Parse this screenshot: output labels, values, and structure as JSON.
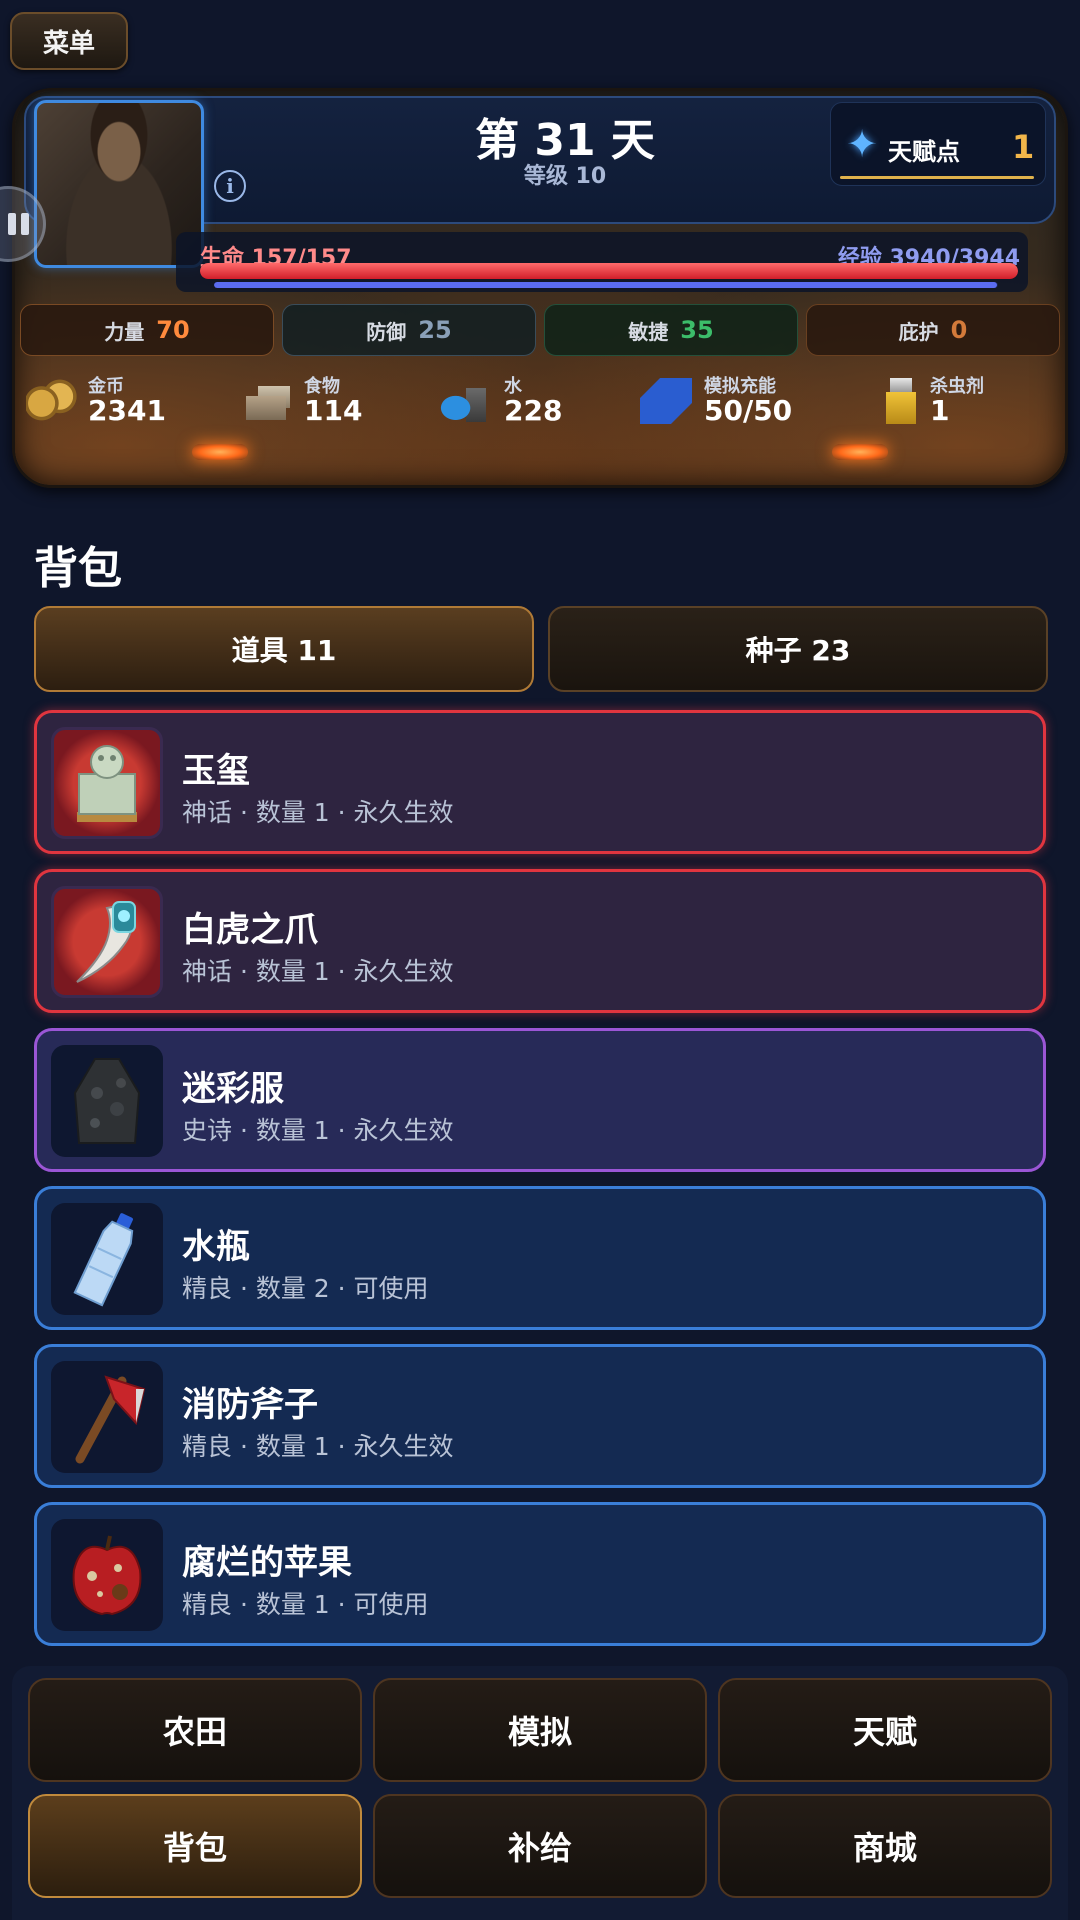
{
  "menu_label": "菜单",
  "header": {
    "day_title": "第 31 天",
    "level_text": "等级 10",
    "talent": {
      "label": "天赋点",
      "value": "1",
      "icon": "crystal-star-icon"
    },
    "hp": {
      "label": "生命 157/157",
      "fraction": 1.0
    },
    "xp": {
      "label": "经验 3940/3944",
      "fraction": 0.999
    },
    "stats": [
      {
        "label": "力量",
        "value": "70"
      },
      {
        "label": "防御",
        "value": "25"
      },
      {
        "label": "敏捷",
        "value": "35"
      },
      {
        "label": "庇护",
        "value": "0"
      }
    ],
    "resources": [
      {
        "label": "金币",
        "value": "2341",
        "icon": "coins-icon"
      },
      {
        "label": "食物",
        "value": "114",
        "icon": "food-crate-icon"
      },
      {
        "label": "水",
        "value": "228",
        "icon": "water-drop-icon"
      },
      {
        "label": "模拟充能",
        "value": "50/50",
        "icon": "battery-icon"
      },
      {
        "label": "杀虫剂",
        "value": "1",
        "icon": "spray-bottle-icon"
      }
    ]
  },
  "backpack": {
    "title": "背包",
    "tabs": [
      {
        "label": "道具 11",
        "active": true
      },
      {
        "label": "种子 23",
        "active": false
      }
    ],
    "items": [
      {
        "name": "玉玺",
        "sub": "神话 · 数量 1 · 永久生效",
        "rarity": "mythic",
        "icon": "jade-seal-icon"
      },
      {
        "name": "白虎之爪",
        "sub": "神话 · 数量 1 · 永久生效",
        "rarity": "mythic",
        "icon": "tiger-claw-icon"
      },
      {
        "name": "迷彩服",
        "sub": "史诗 · 数量 1 · 永久生效",
        "rarity": "epic",
        "icon": "camo-cloak-icon"
      },
      {
        "name": "水瓶",
        "sub": "精良 · 数量 2 · 可使用",
        "rarity": "fine",
        "icon": "water-bottle-icon"
      },
      {
        "name": "消防斧子",
        "sub": "精良 · 数量 1 · 永久生效",
        "rarity": "fine",
        "icon": "fire-axe-icon"
      },
      {
        "name": "腐烂的苹果",
        "sub": "精良 · 数量 1 · 可使用",
        "rarity": "fine",
        "icon": "rotten-apple-icon"
      }
    ]
  },
  "nav": [
    {
      "label": "农田",
      "active": false
    },
    {
      "label": "模拟",
      "active": false
    },
    {
      "label": "天赋",
      "active": false
    },
    {
      "label": "背包",
      "active": true
    },
    {
      "label": "补给",
      "active": false
    },
    {
      "label": "商城",
      "active": false
    }
  ],
  "colors": {
    "mythic_border": "#e0353f",
    "epic_border": "#9b56d6",
    "fine_border": "#3a7ed8",
    "hp": "#e02a34",
    "xp": "#5b6cf0",
    "talent_value": "#f2b64a"
  }
}
